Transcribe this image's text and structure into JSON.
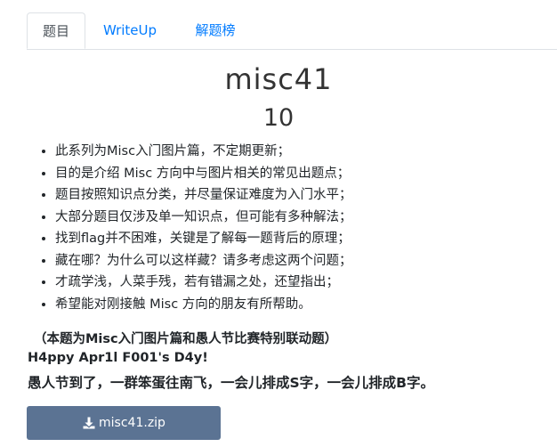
{
  "tabs": {
    "challenge": "题目",
    "writeup": "WriteUp",
    "ranking": "解题榜"
  },
  "challenge": {
    "name": "misc41",
    "points": "10"
  },
  "description": [
    "此系列为Misc入门图片篇，不定期更新；",
    "目的是介绍 Misc 方向中与图片相关的常见出题点；",
    "题目按照知识点分类，并尽量保证难度为入门水平；",
    "大部分题目仅涉及单一知识点，但可能有多种解法；",
    "找到flag并不困难，关键是了解每一题背后的原理；",
    "藏在哪？为什么可以这样藏？请多考虑这两个问题；",
    "才疏学浅，人菜手残，若有错漏之处，还望指出；",
    "希望能对刚接触 Misc 方向的朋友有所帮助。"
  ],
  "notes": {
    "collab": "（本题为Misc入门图片篇和愚人节比赛特别联动题）",
    "happy": "H4ppy Apr1l F001's D4y!",
    "story": "愚人节到了，一群笨蛋往南飞，一会儿排成S字，一会儿排成B字。"
  },
  "attachment": {
    "label": "misc41.zip",
    "icon": "download-icon"
  },
  "colors": {
    "link": "#007bff",
    "button": "#5b7393",
    "border": "#dee2e6"
  }
}
